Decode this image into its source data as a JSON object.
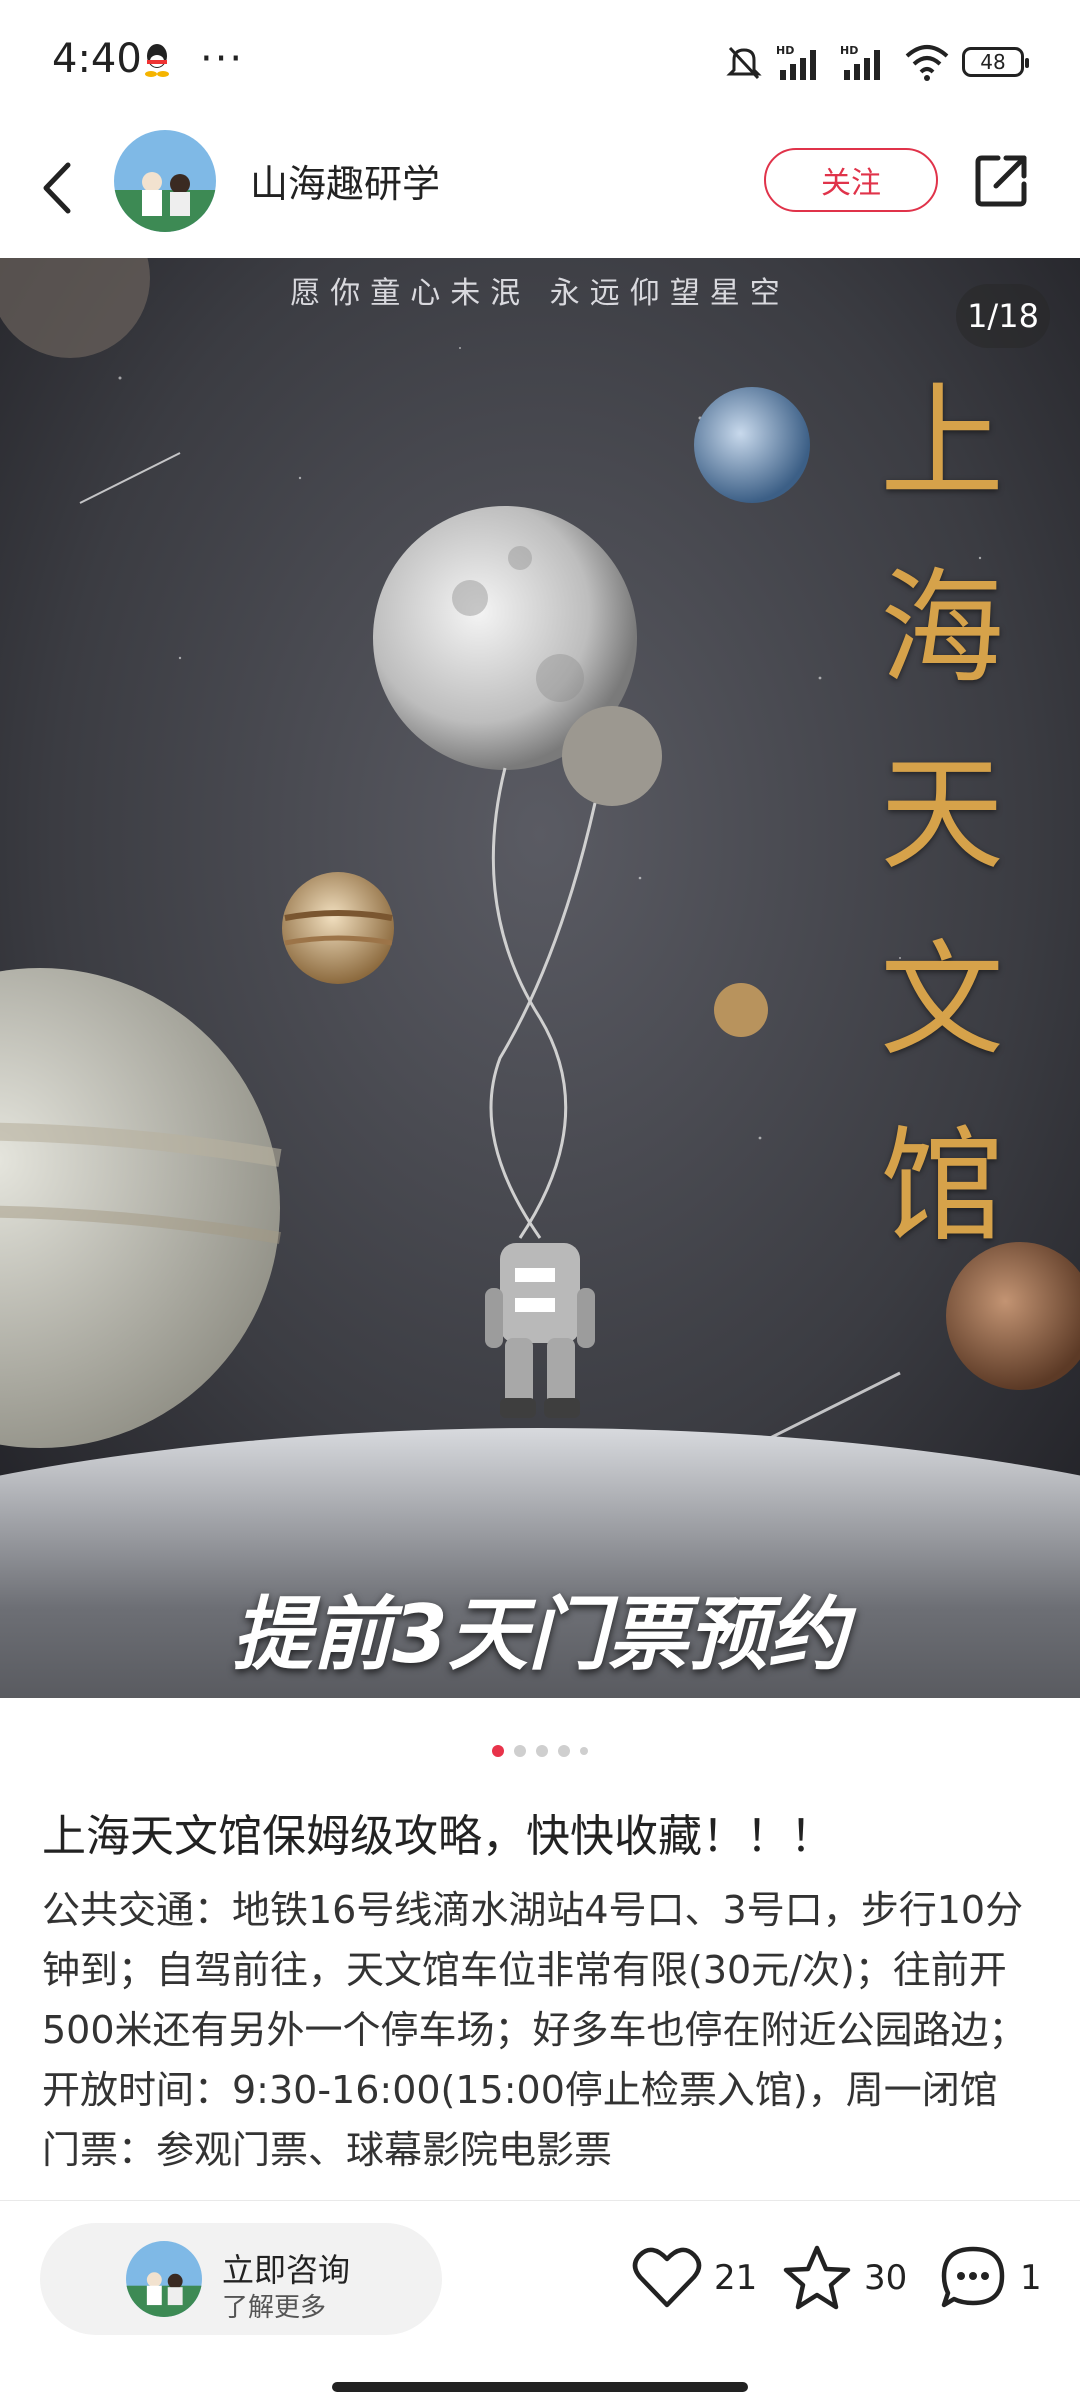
{
  "status_bar": {
    "time": "4:40",
    "more": "···",
    "battery": "48",
    "signal_label_1": "HD",
    "signal_label_2": "HD"
  },
  "header": {
    "author": "山海趣研学",
    "follow_label": "关注"
  },
  "banner": {
    "slogan": "愿你童心未泯    永远仰望星空",
    "title": "上海天文馆",
    "caption": "提前3天门票预约",
    "counter": "1/18"
  },
  "post": {
    "title": "上海天文馆保姆级攻略，快快收藏！！！",
    "paragraphs": [
      "公共交通：地铁16号线滴水湖站4号口、3号口，步行10分钟到；自驾前往，天文馆车位非常有限(30元/次)；往前开500米还有另外一个停车场；好多车也停在附近公园路边；",
      "开放时间：9:30-16:00(15:00停止检票入馆)，周一闭馆",
      "门票：参观门票、球幕影院电影票"
    ]
  },
  "bottom_bar": {
    "consult_title": "立即咨询",
    "consult_sub": "了解更多",
    "likes": "21",
    "stars": "30",
    "comments": "1"
  },
  "colors": {
    "accent": "#e0334a",
    "gold": "#d6a24a"
  }
}
